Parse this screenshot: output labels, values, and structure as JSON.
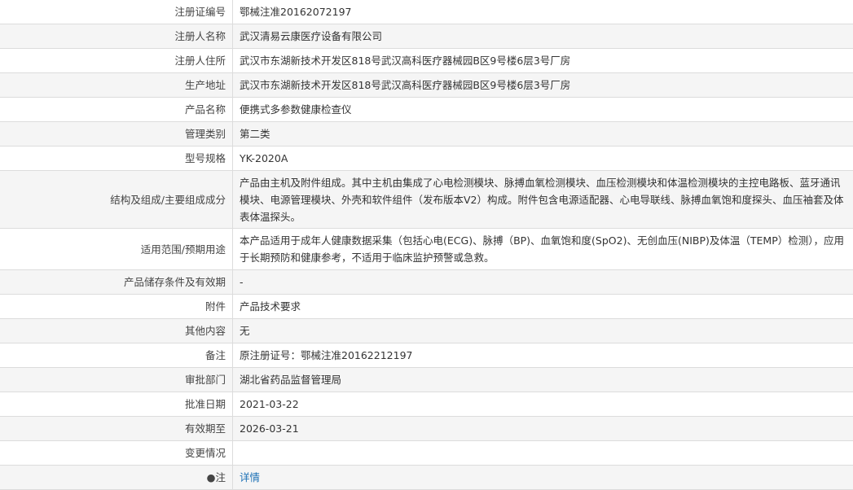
{
  "rows": [
    {
      "label": "注册证编号",
      "value": "鄂械注准20162072197"
    },
    {
      "label": "注册人名称",
      "value": "武汉清易云康医疗设备有限公司"
    },
    {
      "label": "注册人住所",
      "value": "武汉市东湖新技术开发区818号武汉高科医疗器械园B区9号楼6层3号厂房"
    },
    {
      "label": "生产地址",
      "value": "武汉市东湖新技术开发区818号武汉高科医疗器械园B区9号楼6层3号厂房"
    },
    {
      "label": "产品名称",
      "value": "便携式多参数健康检查仪"
    },
    {
      "label": "管理类别",
      "value": "第二类"
    },
    {
      "label": "型号规格",
      "value": "YK-2020A"
    },
    {
      "label": "结构及组成/主要组成成分",
      "value": "产品由主机及附件组成。其中主机由集成了心电检测模块、脉搏血氧检测模块、血压检测模块和体温检测模块的主控电路板、蓝牙通讯模块、电源管理模块、外壳和软件组件（发布版本V2）构成。附件包含电源适配器、心电导联线、脉搏血氧饱和度探头、血压袖套及体表体温探头。"
    },
    {
      "label": "适用范围/预期用途",
      "value": "本产品适用于成年人健康数据采集（包括心电(ECG)、脉搏（BP)、血氧饱和度(SpO2)、无创血压(NIBP)及体温（TEMP）检测），应用于长期预防和健康参考，不适用于临床监护预警或急救。"
    },
    {
      "label": "产品储存条件及有效期",
      "value": "-"
    },
    {
      "label": "附件",
      "value": "产品技术要求"
    },
    {
      "label": "其他内容",
      "value": "无"
    },
    {
      "label": "备注",
      "value": "原注册证号：鄂械注准20162212197"
    },
    {
      "label": "审批部门",
      "value": "湖北省药品监督管理局"
    },
    {
      "label": "批准日期",
      "value": "2021-03-22"
    },
    {
      "label": "有效期至",
      "value": "2026-03-21"
    },
    {
      "label": "变更情况",
      "value": ""
    },
    {
      "label": "●注",
      "value": "详情"
    }
  ]
}
